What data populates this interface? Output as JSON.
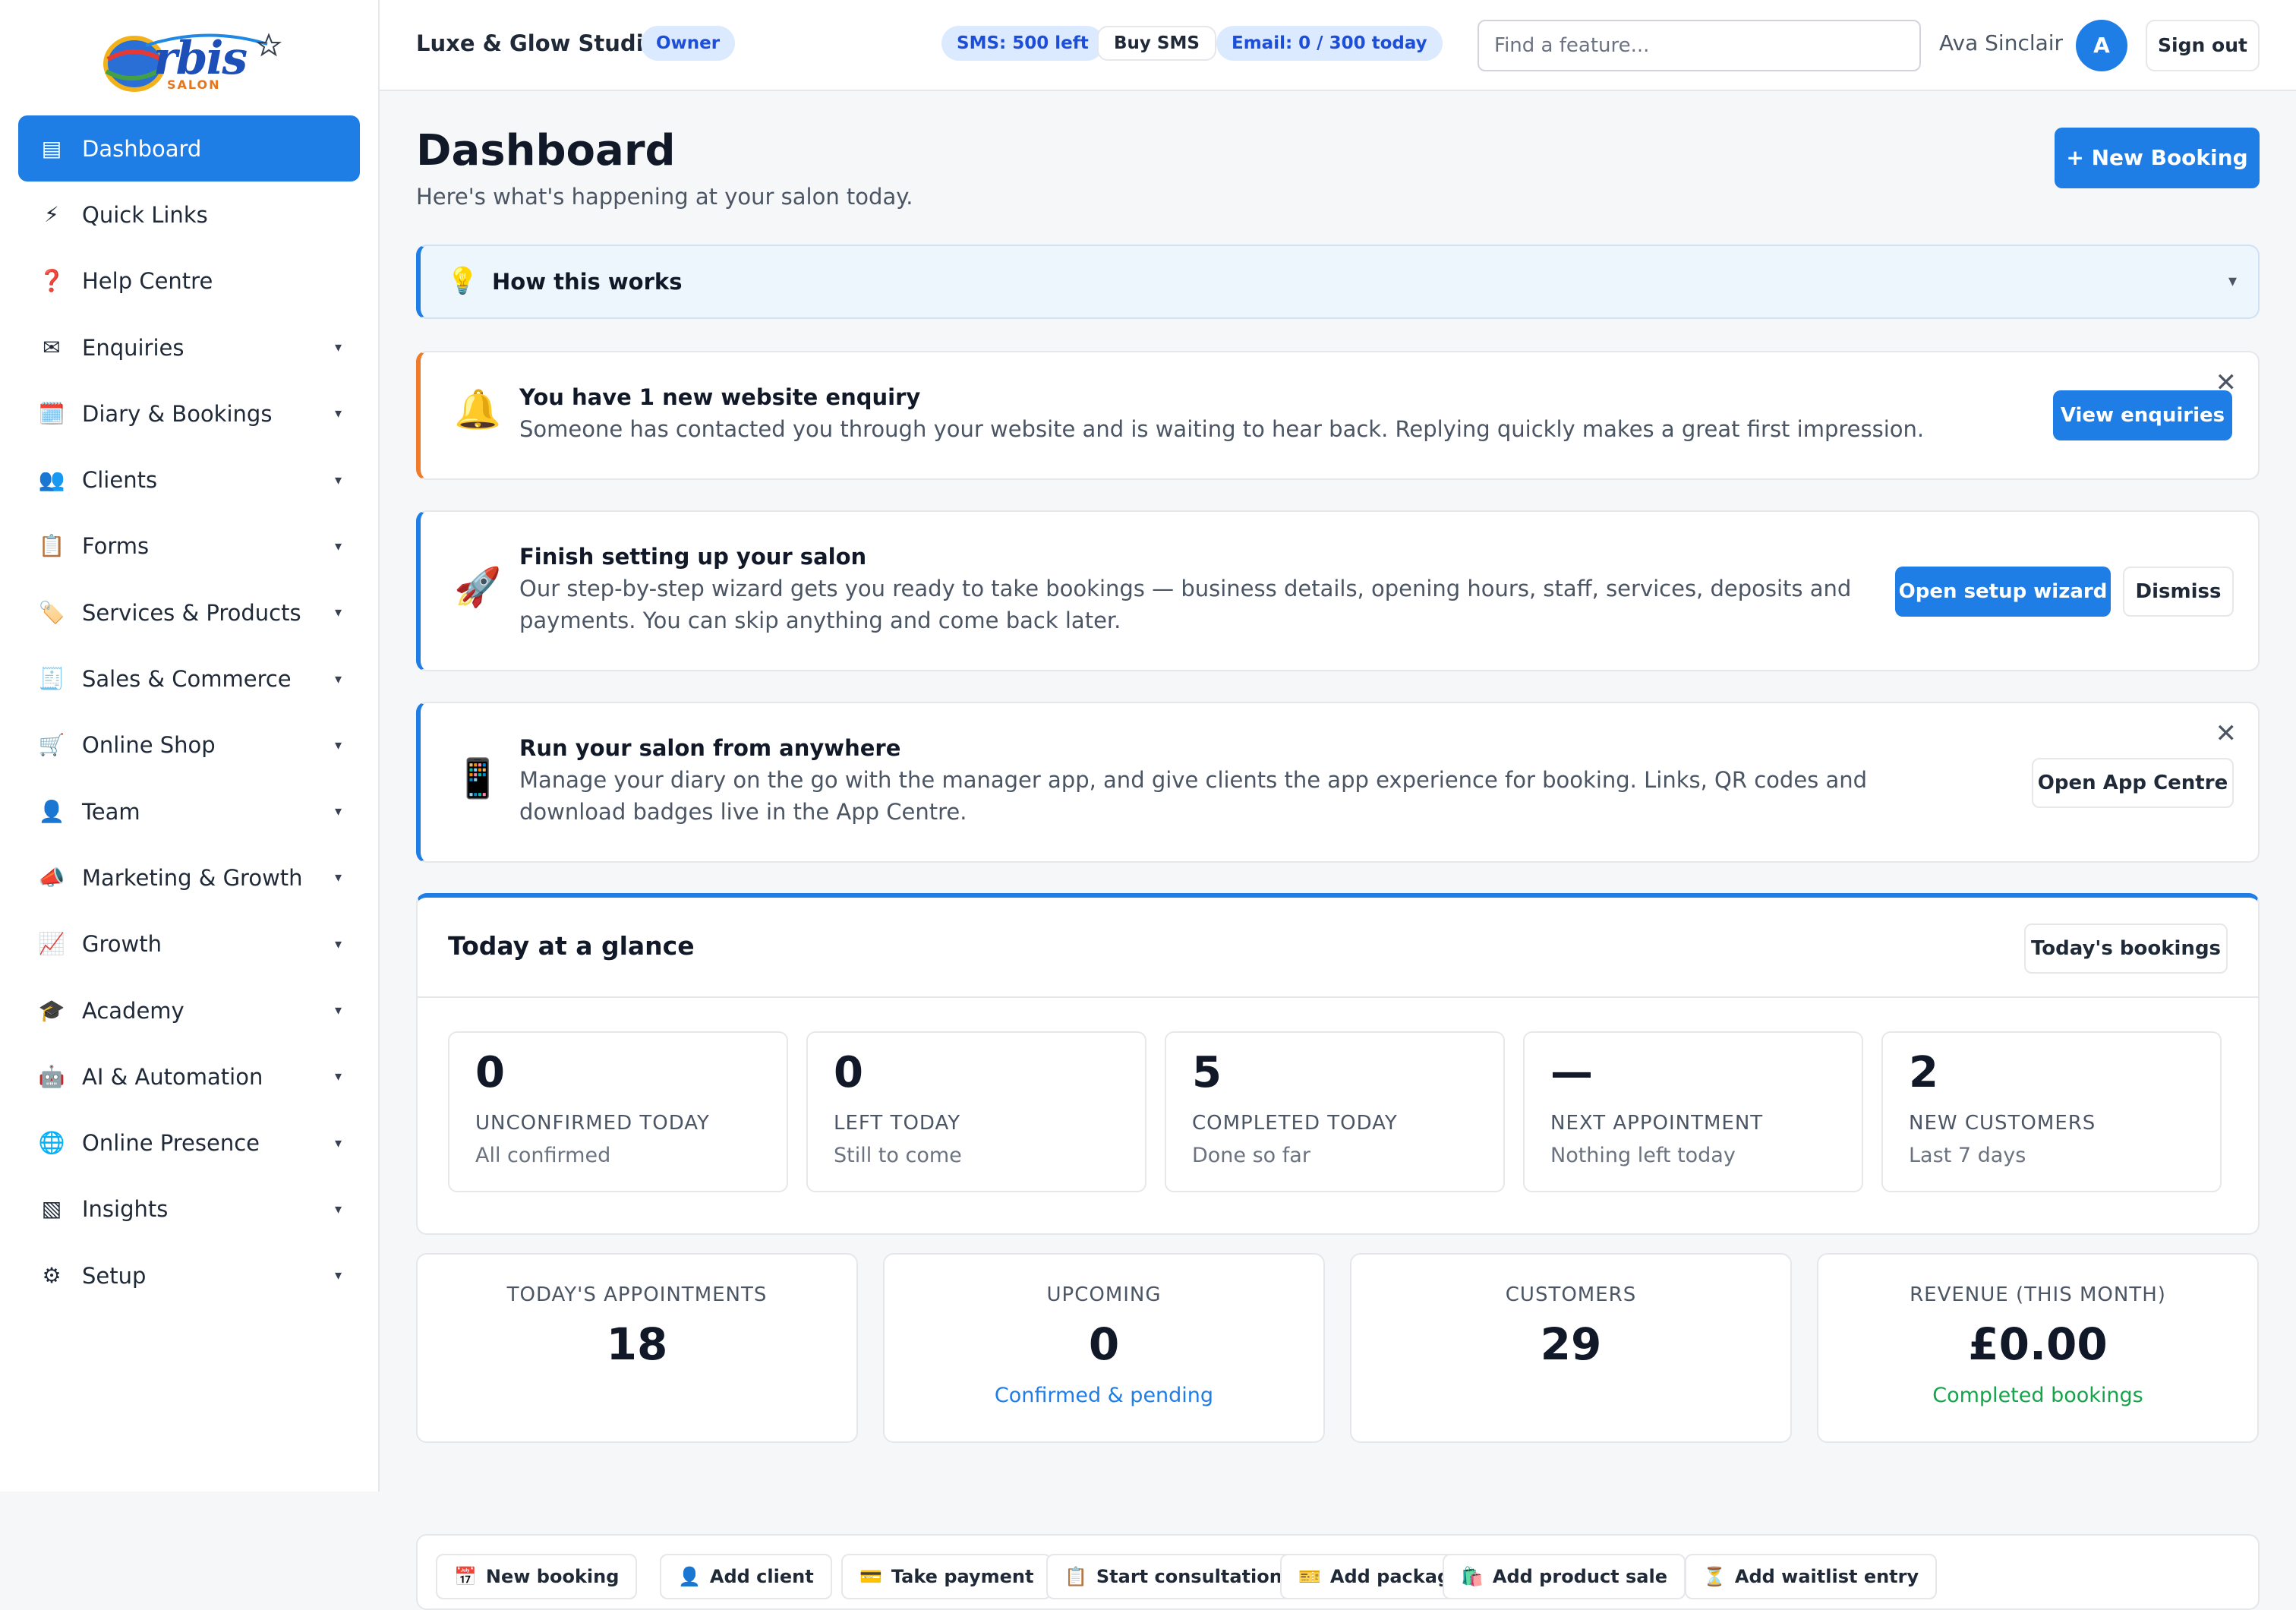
{
  "brand": {
    "logo_word": "rbis",
    "logo_sub": "SALON"
  },
  "sidebar": {
    "items": [
      {
        "icon": "▤",
        "label": "Dashboard",
        "active": true
      },
      {
        "icon": "⚡",
        "label": "Quick Links"
      },
      {
        "icon": "❓",
        "label": "Help Centre"
      },
      {
        "icon": "✉",
        "label": "Enquiries"
      },
      {
        "icon": "🗓️",
        "label": "Diary & Bookings"
      },
      {
        "icon": "👥",
        "label": "Clients"
      },
      {
        "icon": "📋",
        "label": "Forms"
      },
      {
        "icon": "🏷️",
        "label": "Services & Products"
      },
      {
        "icon": "🧾",
        "label": "Sales & Commerce"
      },
      {
        "icon": "🛒",
        "label": "Online Shop"
      },
      {
        "icon": "👤",
        "label": "Team"
      },
      {
        "icon": "📣",
        "label": "Marketing & Growth"
      },
      {
        "icon": "📈",
        "label": "Growth"
      },
      {
        "icon": "🎓",
        "label": "Academy"
      },
      {
        "icon": "🤖",
        "label": "AI & Automation"
      },
      {
        "icon": "🌐",
        "label": "Online Presence"
      },
      {
        "icon": "▧",
        "label": "Insights"
      },
      {
        "icon": "⚙",
        "label": "Setup"
      }
    ],
    "chevron": "▾"
  },
  "header": {
    "salon_name": "Luxe & Glow Studio",
    "role_badge": "Owner",
    "sms_badge": "SMS: 500 left",
    "buy_sms": "Buy SMS",
    "email_badge": "Email: 0 / 300 today",
    "search_placeholder": "Find a feature...",
    "user_name": "Ava Sinclair",
    "avatar_initial": "A",
    "sign_out": "Sign out"
  },
  "main": {
    "title": "Dashboard",
    "subtitle": "Here's what's happening at your salon today.",
    "new_booking": "+ New Booking",
    "how_this_works": {
      "icon": "💡",
      "title": "How this works",
      "chevron": "▾"
    },
    "enquiry": {
      "icon": "🔔",
      "title": "You have 1 new website enquiry",
      "text": "Someone has contacted you through your website and is waiting to hear back. Replying quickly makes a great first impression.",
      "button": "View enquiries",
      "close": "✕"
    },
    "setup": {
      "icon": "🚀",
      "title": "Finish setting up your salon",
      "text": "Our step-by-step wizard gets you ready to take bookings — business details, opening hours, staff, services, deposits and payments. You can skip anything and come back later.",
      "button": "Open setup wizard",
      "dismiss": "Dismiss"
    },
    "app": {
      "icon": "📱",
      "title": "Run your salon from anywhere",
      "text": "Manage your diary on the go with the manager app, and give clients the app experience for booking. Links, QR codes and download badges live in the App Centre.",
      "button": "Open App Centre",
      "close": "✕"
    },
    "glance": {
      "title": "Today at a glance",
      "button": "Today's bookings",
      "stats": [
        {
          "num": "0",
          "cap": "UNCONFIRMED TODAY",
          "sub": "All confirmed"
        },
        {
          "num": "0",
          "cap": "LEFT TODAY",
          "sub": "Still to come"
        },
        {
          "num": "5",
          "cap": "COMPLETED TODAY",
          "sub": "Done so far"
        },
        {
          "num": "—",
          "cap": "NEXT APPOINTMENT",
          "sub": "Nothing left today"
        },
        {
          "num": "2",
          "cap": "NEW CUSTOMERS",
          "sub": "Last 7 days"
        }
      ]
    },
    "kpis": [
      {
        "cap": "TODAY'S APPOINTMENTS",
        "num": "18",
        "sub": ""
      },
      {
        "cap": "UPCOMING",
        "num": "0",
        "sub": "Confirmed & pending",
        "sub_color": "#1f7de6"
      },
      {
        "cap": "CUSTOMERS",
        "num": "29",
        "sub": ""
      },
      {
        "cap": "REVENUE (THIS MONTH)",
        "num": "£0.00",
        "sub": "Completed bookings",
        "sub_color": "#16a34a"
      }
    ],
    "quick_actions": [
      {
        "icon": "📅",
        "label": "New booking"
      },
      {
        "icon": "👤",
        "label": "Add client"
      },
      {
        "icon": "💳",
        "label": "Take payment"
      },
      {
        "icon": "📋",
        "label": "Start consultation"
      },
      {
        "icon": "🎫",
        "label": "Add package"
      },
      {
        "icon": "🛍️",
        "label": "Add product sale"
      },
      {
        "icon": "⏳",
        "label": "Add waitlist entry"
      }
    ]
  }
}
